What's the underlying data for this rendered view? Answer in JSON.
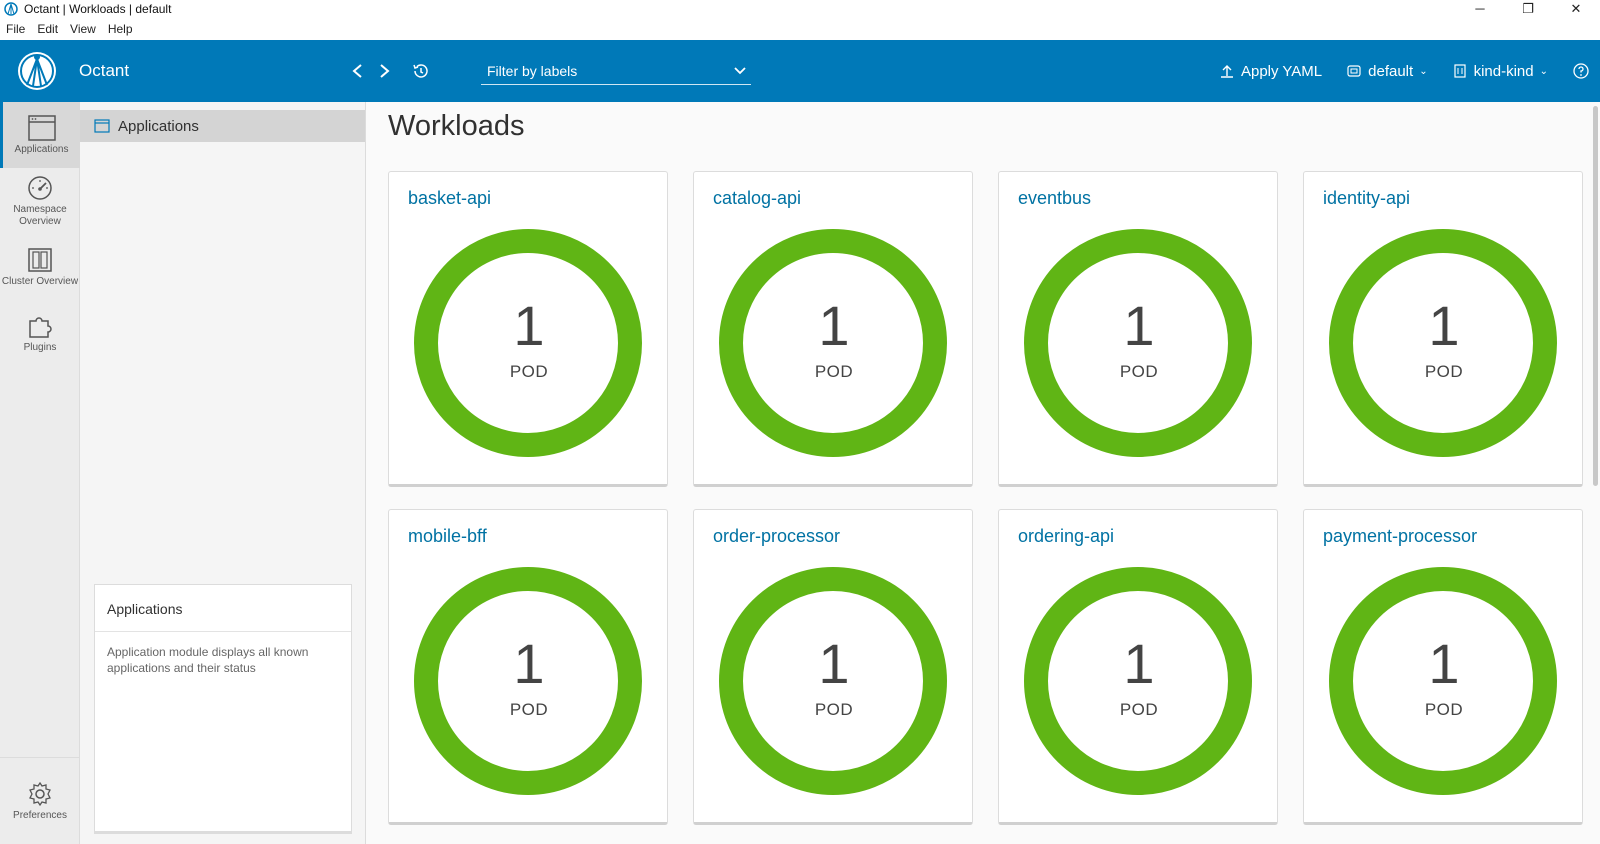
{
  "window": {
    "title": "Octant | Workloads | default",
    "controls": [
      "─",
      "❐",
      "✕"
    ]
  },
  "menu": [
    "File",
    "Edit",
    "View",
    "Help"
  ],
  "header": {
    "brand": "Octant",
    "filter_placeholder": "Filter by labels",
    "apply_yaml": "Apply YAML",
    "namespace": "default",
    "context": "kind-kind"
  },
  "rail": [
    {
      "label": "Applications",
      "icon": "applications-icon"
    },
    {
      "label": "Namespace Overview",
      "icon": "gauge-icon"
    },
    {
      "label": "Cluster Overview",
      "icon": "cluster-icon"
    },
    {
      "label": "Plugins",
      "icon": "puzzle-icon"
    }
  ],
  "rail_bottom": {
    "label": "Preferences",
    "icon": "gear-icon"
  },
  "subnav": {
    "item": "Applications"
  },
  "info": {
    "title": "Applications",
    "body": "Application module displays all known applications and their status"
  },
  "page": {
    "title": "Workloads"
  },
  "colors": {
    "accent": "#0079b8",
    "ok": "#60b515",
    "link": "#0072a3"
  },
  "workloads": [
    {
      "name": "basket-api",
      "count": "1",
      "unit": "POD"
    },
    {
      "name": "catalog-api",
      "count": "1",
      "unit": "POD"
    },
    {
      "name": "eventbus",
      "count": "1",
      "unit": "POD"
    },
    {
      "name": "identity-api",
      "count": "1",
      "unit": "POD"
    },
    {
      "name": "mobile-bff",
      "count": "1",
      "unit": "POD"
    },
    {
      "name": "order-processor",
      "count": "1",
      "unit": "POD"
    },
    {
      "name": "ordering-api",
      "count": "1",
      "unit": "POD"
    },
    {
      "name": "payment-processor",
      "count": "1",
      "unit": "POD"
    }
  ]
}
